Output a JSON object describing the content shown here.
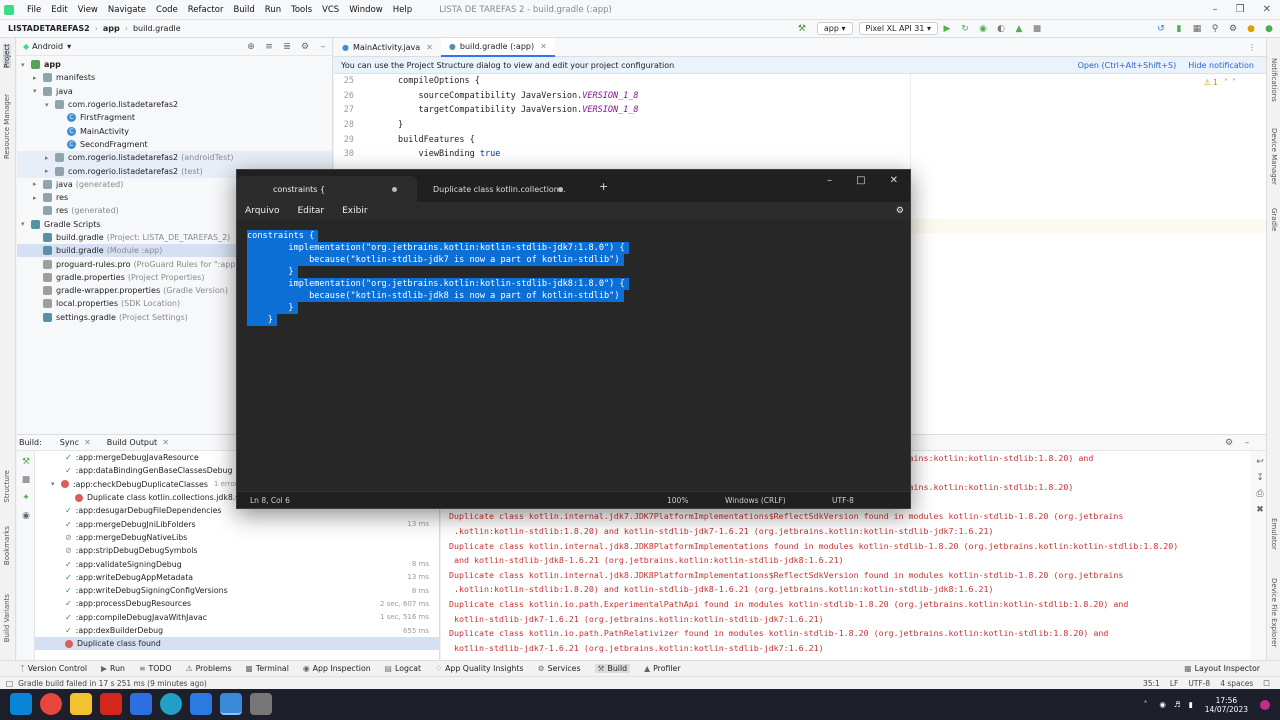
{
  "menu": {
    "items": [
      "File",
      "Edit",
      "View",
      "Navigate",
      "Code",
      "Refactor",
      "Build",
      "Run",
      "Tools",
      "VCS",
      "Window",
      "Help"
    ],
    "window_title": "LISTA DE TAREFAS 2 - build.gradle (:app)"
  },
  "nav": {
    "project": "LISTADETAREFAS2",
    "module": "app",
    "file": "build.gradle",
    "run_config": "app",
    "device": "Pixel XL API 31"
  },
  "left_stripe": [
    "Project",
    "Resource Manager",
    "Structure",
    "Bookmarks",
    "Build Variants"
  ],
  "right_stripe": [
    "Notifications",
    "Device Manager",
    "Gradle",
    "Emulator",
    "Device File Explorer"
  ],
  "project_panel": {
    "view": "Android",
    "tree": [
      {
        "label": "app",
        "dim": ""
      },
      {
        "label": "manifests",
        "dim": ""
      },
      {
        "label": "java",
        "dim": ""
      },
      {
        "label": "com.rogerio.listadetarefas2",
        "dim": ""
      },
      {
        "label": "FirstFragment",
        "dim": ""
      },
      {
        "label": "MainActivity",
        "dim": ""
      },
      {
        "label": "SecondFragment",
        "dim": ""
      },
      {
        "label": "com.rogerio.listadetarefas2",
        "dim": "(androidTest)"
      },
      {
        "label": "com.rogerio.listadetarefas2",
        "dim": "(test)"
      },
      {
        "label": "java",
        "dim": "(generated)"
      },
      {
        "label": "res",
        "dim": ""
      },
      {
        "label": "res",
        "dim": "(generated)"
      },
      {
        "label": "Gradle Scripts",
        "dim": ""
      },
      {
        "label": "build.gradle",
        "dim": "(Project: LISTA_DE_TAREFAS_2)"
      },
      {
        "label": "build.gradle",
        "dim": "(Module :app)"
      },
      {
        "label": "proguard-rules.pro",
        "dim": "(ProGuard Rules for \":app\")"
      },
      {
        "label": "gradle.properties",
        "dim": "(Project Properties)"
      },
      {
        "label": "gradle-wrapper.properties",
        "dim": "(Gradle Version)"
      },
      {
        "label": "local.properties",
        "dim": "(SDK Location)"
      },
      {
        "label": "settings.gradle",
        "dim": "(Project Settings)"
      }
    ]
  },
  "editor": {
    "tabs": [
      "MainActivity.java",
      "build.gradle (:app)"
    ],
    "notice": "You can use the Project Structure dialog to view and edit your project configuration",
    "notice_open": "Open (Ctrl+Alt+Shift+S)",
    "notice_hide": "Hide notification",
    "warning_count": "1",
    "line_numbers": [
      "25",
      "26",
      "27",
      "28",
      "29",
      "30"
    ],
    "lines": [
      {
        "text": "compileOptions {",
        "const": ""
      },
      {
        "text": "    sourceCompatibility JavaVersion.",
        "const": "VERSION_1_8"
      },
      {
        "text": "    targetCompatibility JavaVersion.",
        "const": "VERSION_1_8"
      },
      {
        "text": "}",
        "const": ""
      },
      {
        "text": "buildFeatures {",
        "const": ""
      },
      {
        "text": "    viewBinding ",
        "const": "true"
      }
    ]
  },
  "notepad": {
    "tab1": "constraints {",
    "tab2": "Duplicate class kotlin.collections.",
    "menu": [
      "Arquivo",
      "Editar",
      "Exibir"
    ],
    "lines": [
      "constraints {",
      "        implementation(\"org.jetbrains.kotlin:kotlin-stdlib-jdk7:1.8.0\") {",
      "            because(\"kotlin-stdlib-jdk7 is now a part of kotlin-stdlib\")",
      "        }",
      "        implementation(\"org.jetbrains.kotlin:kotlin-stdlib-jdk8:1.8.0\") {",
      "            because(\"kotlin-stdlib-jdk8 is now a part of kotlin-stdlib\")",
      "        }",
      "    }"
    ],
    "status": {
      "pos": "Ln 8, Col 6",
      "zoom": "100%",
      "eol": "Windows (CRLF)",
      "enc": "UTF-8"
    }
  },
  "build": {
    "header": {
      "label": "Build:",
      "sync": "Sync",
      "output": "Build Output"
    },
    "tasks": [
      {
        "label": ":app:mergeDebugJavaResource",
        "time": "",
        "status": "ok"
      },
      {
        "label": ":app:dataBindingGenBaseClassesDebug",
        "time": "",
        "status": "ok"
      },
      {
        "label": ":app:checkDebugDuplicateClasses",
        "time": "1 error",
        "status": "err"
      },
      {
        "label": "Duplicate class kotlin.collections.jdk8.Colle",
        "time": "",
        "status": "err"
      },
      {
        "label": ":app:desugarDebugFileDependencies",
        "time": "",
        "status": "ok"
      },
      {
        "label": ":app:mergeDebugJniLibFolders",
        "time": "13 ms",
        "status": "ok"
      },
      {
        "label": ":app:mergeDebugNativeLibs",
        "time": "",
        "status": "skip"
      },
      {
        "label": ":app:stripDebugDebugSymbols",
        "time": "",
        "status": "skip"
      },
      {
        "label": ":app:validateSigningDebug",
        "time": "8 ms",
        "status": "ok"
      },
      {
        "label": ":app:writeDebugAppMetadata",
        "time": "13 ms",
        "status": "ok"
      },
      {
        "label": ":app:writeDebugSigningConfigVersions",
        "time": "8 ms",
        "status": "ok"
      },
      {
        "label": ":app:processDebugResources",
        "time": "2 sec, 607 ms",
        "status": "ok"
      },
      {
        "label": ":app:compileDebugJavaWithJavac",
        "time": "1 sec, 516 ms",
        "status": "ok"
      },
      {
        "label": ":app:dexBuilderDebug",
        "time": "655 ms",
        "status": "ok"
      },
      {
        "label": "Duplicate class found",
        "time": "",
        "status": "err"
      }
    ],
    "output": [
      "                                                                          -1.8.20 (org.jetbrains:kotlin:kotlin-stdlib:1.8.20) and",
      "",
      "                                                                          -1.8.20 (org.jetbrains.kotlin:kotlin-stdlib:1.8.20)",
      "",
      "Duplicate class kotlin.internal.jdk7.JDK7PlatformImplementations$ReflectSdkVersion found in modules kotlin-stdlib-1.8.20 (org.jetbrains",
      " .kotlin:kotlin-stdlib:1.8.20) and kotlin-stdlib-jdk7-1.6.21 (org.jetbrains.kotlin:kotlin-stdlib-jdk7:1.6.21)",
      "Duplicate class kotlin.internal.jdk8.JDK8PlatformImplementations found in modules kotlin-stdlib-1.8.20 (org.jetbrains.kotlin:kotlin-stdlib:1.8.20)",
      " and kotlin-stdlib-jdk8-1.6.21 (org.jetbrains.kotlin:kotlin-stdlib-jdk8:1.6.21)",
      "Duplicate class kotlin.internal.jdk8.JDK8PlatformImplementations$ReflectSdkVersion found in modules kotlin-stdlib-1.8.20 (org.jetbrains",
      " .kotlin:kotlin-stdlib:1.8.20) and kotlin-stdlib-jdk8-1.6.21 (org.jetbrains.kotlin:kotlin-stdlib-jdk8:1.6.21)",
      "Duplicate class kotlin.io.path.ExperimentalPathApi found in modules kotlin-stdlib-1.8.20 (org.jetbrains.kotlin:kotlin-stdlib:1.8.20) and",
      " kotlin-stdlib-jdk7-1.6.21 (org.jetbrains.kotlin:kotlin-stdlib-jdk7:1.6.21)",
      "Duplicate class kotlin.io.path.PathRelativizer found in modules kotlin-stdlib-1.8.20 (org.jetbrains.kotlin:kotlin-stdlib:1.8.20) and",
      " kotlin-stdlib-jdk7-1.6.21 (org.jetbrains.kotlin:kotlin-stdlib-jdk7:1.6.21)"
    ]
  },
  "toolwindows": [
    "Version Control",
    "Run",
    "TODO",
    "Problems",
    "Terminal",
    "App Inspection",
    "Logcat",
    "App Quality Insights",
    "Services",
    "Build",
    "Profiler",
    "Layout Inspector"
  ],
  "status": {
    "message": "Gradle build failed in 17 s 251 ms (9 minutes ago)",
    "pos": "35:1",
    "eol": "LF",
    "enc": "UTF-8",
    "indent": "4 spaces"
  },
  "taskbar": {
    "time": "17:56",
    "date": "14/07/2023"
  },
  "colors": {
    "accent": "#3574f0",
    "error": "#c83232",
    "selection": "#0b6fd6"
  }
}
